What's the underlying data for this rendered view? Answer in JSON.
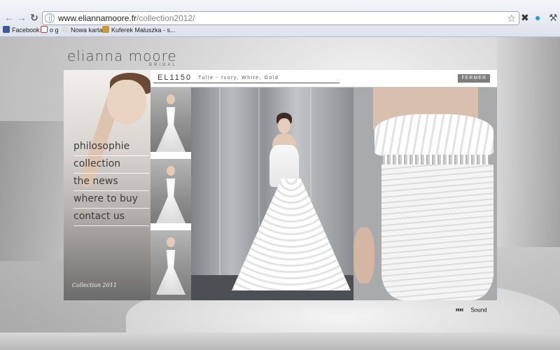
{
  "browser": {
    "url_domain": "www.eliannamoore.fr",
    "url_path": "/collection2012/",
    "bookmarks": [
      {
        "label": "Facebook",
        "icon": "facebook-icon"
      },
      {
        "label": "o g",
        "icon": "gmail-icon"
      },
      {
        "label": "Nowa karta",
        "icon": "new-tab-icon"
      },
      {
        "label": "Kuferek Maluszka - s...",
        "icon": "bookmark-icon"
      }
    ]
  },
  "site": {
    "logo_name": "elianna moore",
    "logo_sub": "BRIDAL",
    "menu": [
      "philosophie",
      "collection",
      "the news",
      "where to buy",
      "contact us"
    ],
    "collection_mark": "Collection 2011",
    "product_code": "EL1150",
    "product_fabric": "Tulle - Ivory, White, Gold",
    "close_label": "FERMER",
    "sound_label": "Sound"
  }
}
